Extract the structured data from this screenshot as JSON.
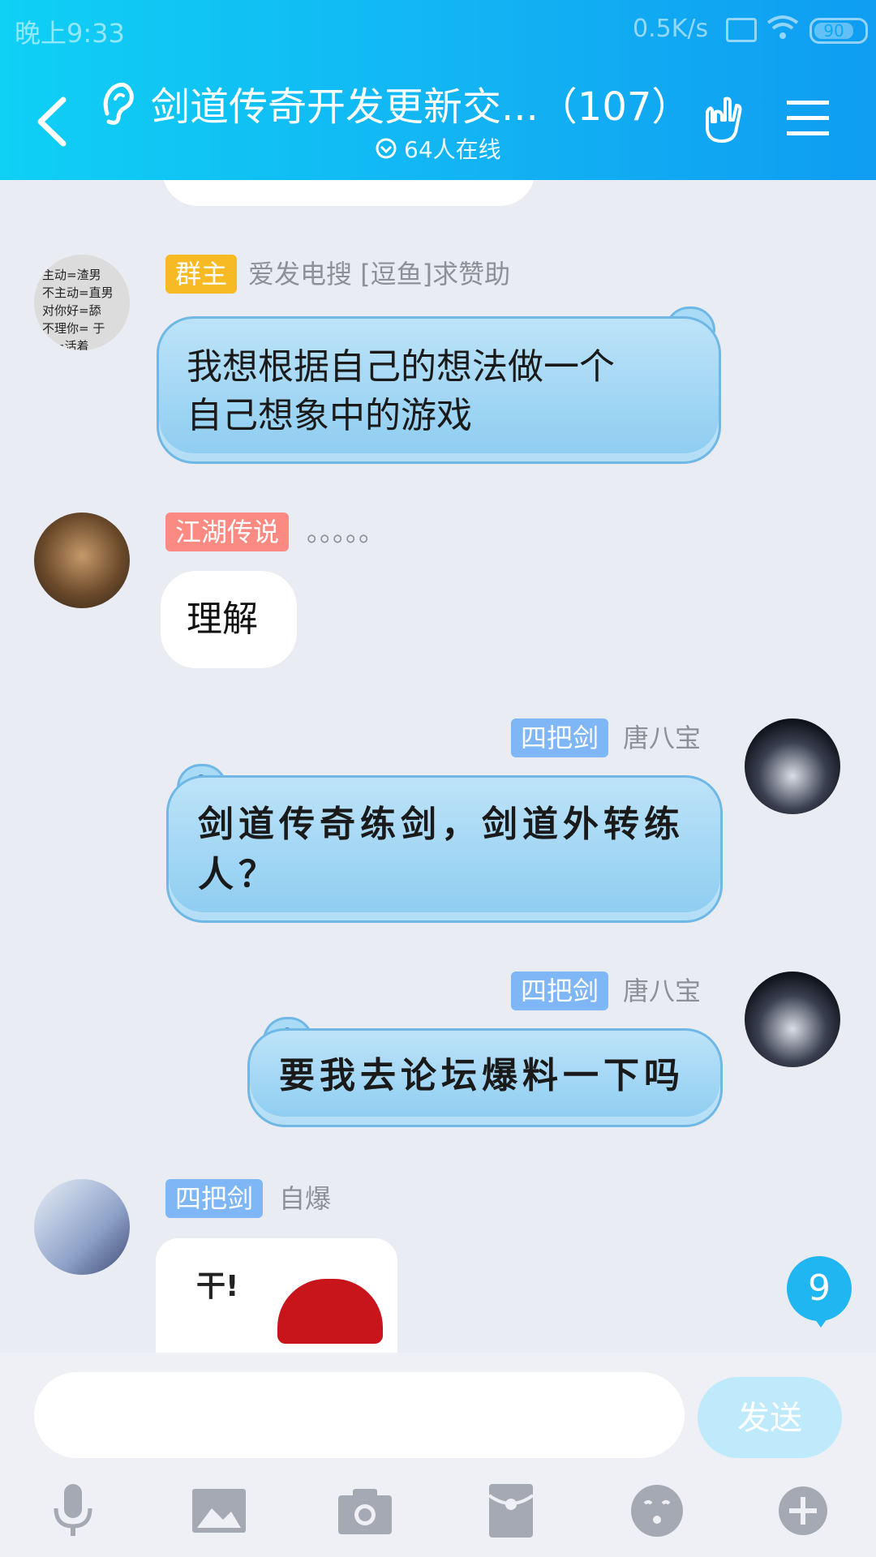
{
  "status_bar": {
    "time": "晚上9:33",
    "network_speed": "0.5K/s",
    "battery": "90"
  },
  "header": {
    "title": "剑道传奇开发更新交...（107）",
    "online": "64人在线"
  },
  "messages": [
    {
      "tag": "群主",
      "name": "爱发电搜 [逗鱼]求赞助",
      "text_line1": "我想根据自己的想法做一个",
      "text_line2": "自己想象中的游戏",
      "avatar_text": [
        "主动=渣男",
        "不主动=直男",
        "对你好=舔",
        "不理你=  于",
        "  人=活着"
      ]
    },
    {
      "tag": "江湖传说",
      "name": "。。。。。",
      "text": "理解"
    },
    {
      "tag": "四把剑",
      "name": "唐八宝",
      "text_line1": "剑道传奇练剑，剑道外转练",
      "text_line2": "人？"
    },
    {
      "tag": "四把剑",
      "name": "唐八宝",
      "text": "要我去论坛爆料一下吗"
    },
    {
      "tag": "四把剑",
      "name": "自爆",
      "image_text": "干!"
    }
  ],
  "unread_badge": "9",
  "input": {
    "placeholder": "",
    "send_label": "发送"
  },
  "colors": {
    "tag_owner": "#f7b924",
    "tag_legend": "#fb8a82",
    "tag_sword": "#7fb6f5",
    "accent": "#12b3f3"
  }
}
